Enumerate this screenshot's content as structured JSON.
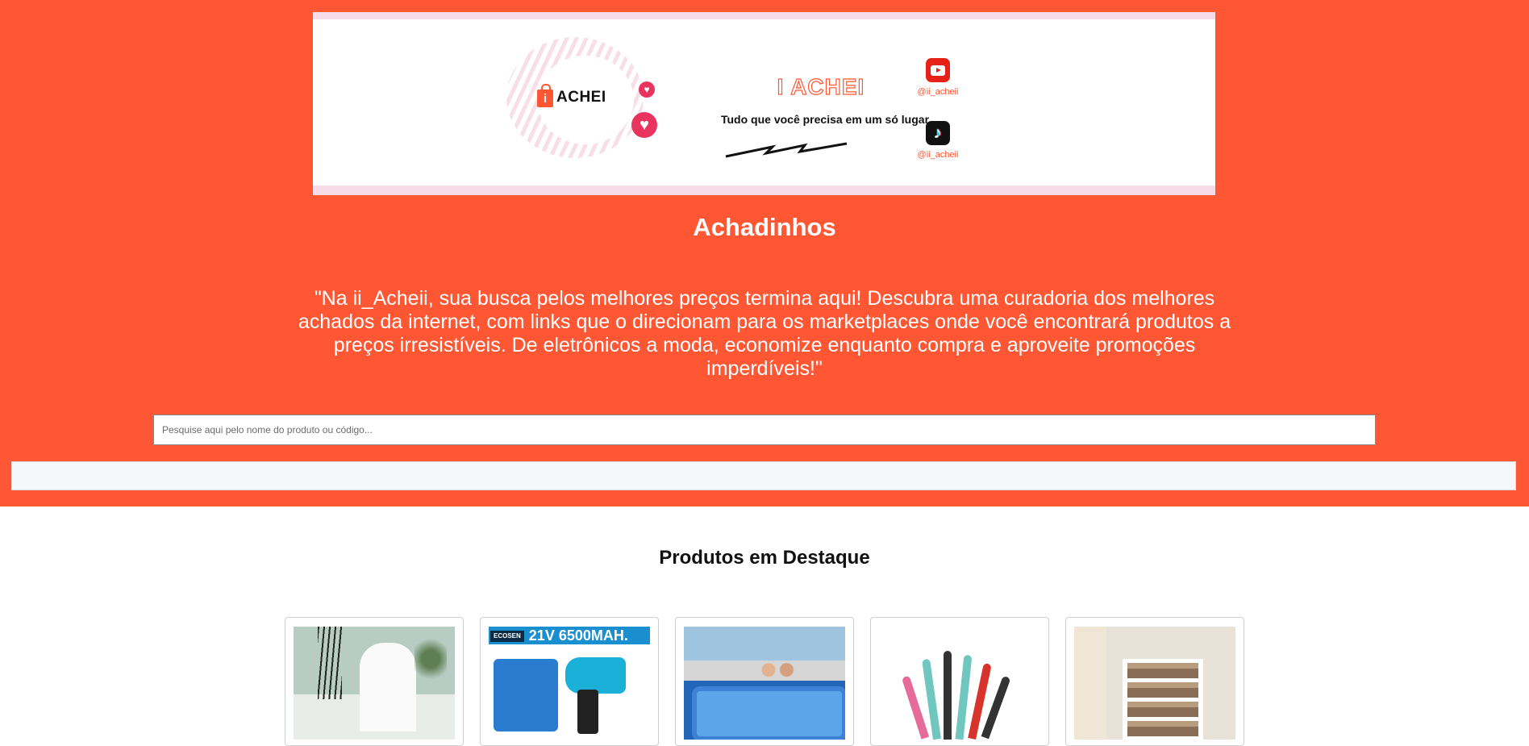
{
  "banner": {
    "logo_text": "ACHEI",
    "brand_title": "I ACHEI",
    "brand_tagline": "Tudo que você precisa em um só lugar",
    "social": [
      {
        "icon": "youtube-icon",
        "handle": "@ii_acheii"
      },
      {
        "icon": "tiktok-icon",
        "handle": "@ii_acheii"
      }
    ]
  },
  "header": {
    "title": "Achadinhos",
    "tagline": "\"Na ii_Acheii, sua busca pelos melhores preços termina aqui! Descubra uma curadoria dos melhores achados da internet, com links que o direcionam para os marketplaces onde você encontrará produtos a preços irresistíveis. De eletrônicos a moda, economize enquanto compra e aproveite promoções imperdíveis!\""
  },
  "search": {
    "placeholder": "Pesquise aqui pelo nome do produto ou código...",
    "value": ""
  },
  "featured": {
    "title": "Produtos em Destaque",
    "products": [
      {
        "image": "aroma-diffuser-product-image"
      },
      {
        "image": "cordless-drill-product-image",
        "image_text": "21V 6500MAH.",
        "brand": "ECOSEN"
      },
      {
        "image": "inflatable-pool-product-image"
      },
      {
        "image": "silicone-kitchen-utensils-product-image"
      },
      {
        "image": "shoe-rack-product-image"
      }
    ]
  },
  "colors": {
    "hero_background": "#ff5733",
    "accent_pink": "#e8345f",
    "banner_border": "#f7dbe6"
  }
}
